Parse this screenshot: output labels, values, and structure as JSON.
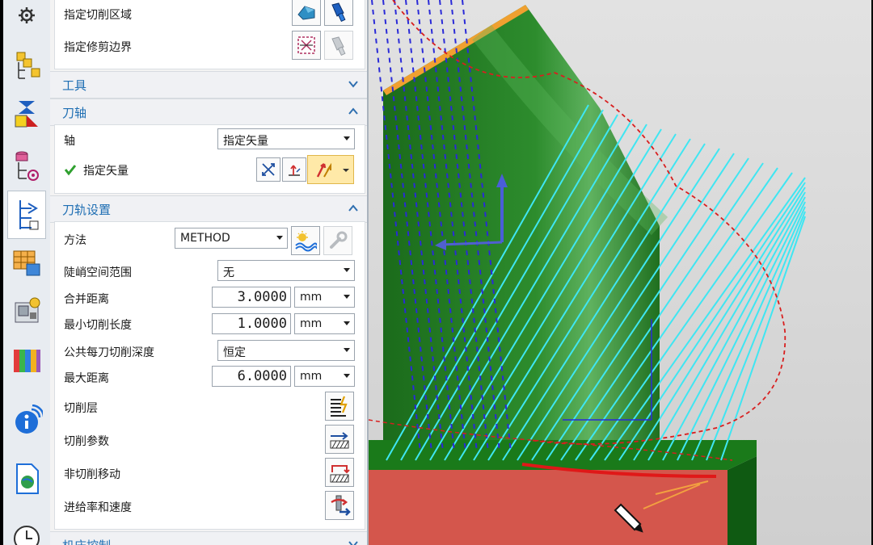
{
  "resource_bar": {
    "items": [
      {
        "name": "settings-icon"
      },
      {
        "name": "assembly-navigator-icon"
      },
      {
        "name": "constraint-navigator-icon"
      },
      {
        "name": "part-navigator-icon"
      },
      {
        "name": "operation-navigator-icon"
      },
      {
        "name": "machine-navigator-icon"
      },
      {
        "name": "machine-tool-icon"
      },
      {
        "name": "library-icon"
      },
      {
        "name": "info-icon"
      },
      {
        "name": "web-document-icon"
      },
      {
        "name": "history-clock-icon"
      }
    ]
  },
  "panel": {
    "geometry": {
      "cut_area_label": "指定切削区域",
      "trim_boundary_label": "指定修剪边界"
    },
    "tools_section": "工具",
    "tool_axis": {
      "title": "刀轴",
      "axis_label": "轴",
      "axis_value": "指定矢量",
      "vector_label": "指定矢量"
    },
    "path_settings": {
      "title": "刀轨设置",
      "method_label": "方法",
      "method_value": "METHOD",
      "steep_label": "陡峭空间范围",
      "steep_value": "无",
      "merge_label": "合并距离",
      "merge_value": "3.0000",
      "merge_unit": "mm",
      "min_cut_label": "最小切削长度",
      "min_cut_value": "1.0000",
      "min_cut_unit": "mm",
      "depth_label": "公共每刀切削深度",
      "depth_value": "恒定",
      "max_dist_label": "最大距离",
      "max_dist_value": "6.0000",
      "max_dist_unit": "mm",
      "cut_levels_label": "切削层",
      "cut_params_label": "切削参数",
      "non_cut_label": "非切削移动",
      "feeds_label": "进给率和速度"
    },
    "machine_control_section": "机床控制"
  },
  "colors": {
    "section_title": "#1e6eb3",
    "part_green": "#1d7a1d",
    "stock_red": "#d4564c",
    "toolpath_cyan": "#3fe6f2",
    "path_blue": "#2a2ad8",
    "boundary_red": "#d81f1f"
  }
}
